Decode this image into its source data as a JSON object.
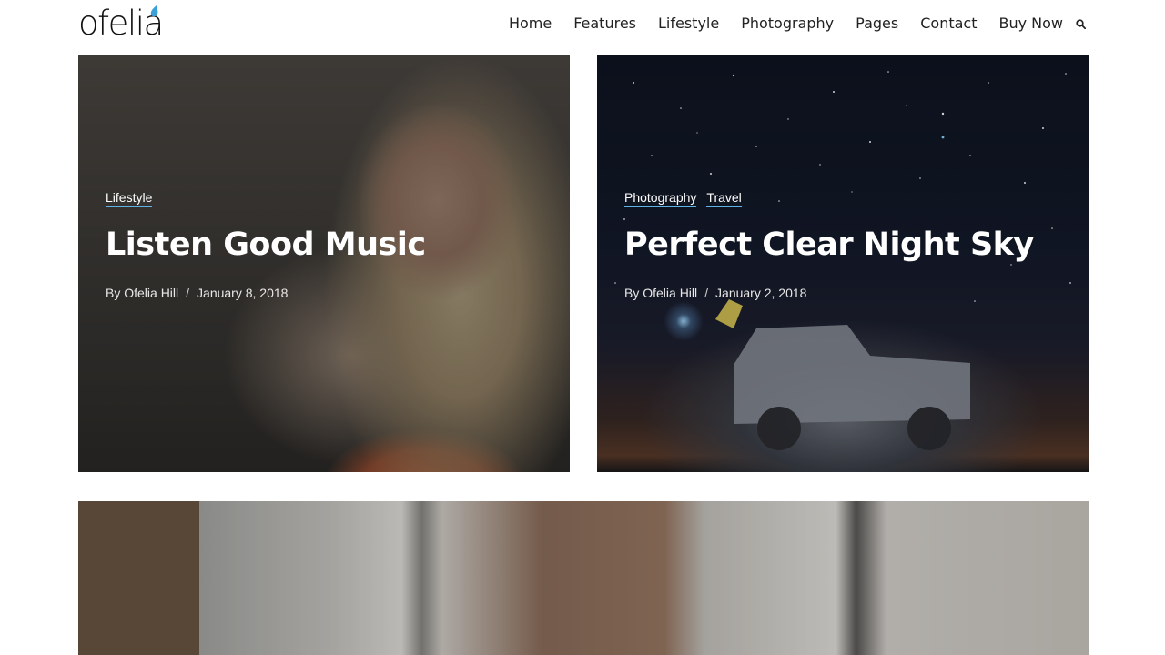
{
  "header": {
    "logo_text": "ofelia",
    "nav": [
      "Home",
      "Features",
      "Lifestyle",
      "Photography",
      "Pages",
      "Contact",
      "Buy Now"
    ],
    "search_icon": "search-icon"
  },
  "posts": [
    {
      "categories": [
        "Lifestyle"
      ],
      "title": "Listen Good Music",
      "author": "By Ofelia Hill",
      "separator": "/",
      "date": "January 8, 2018"
    },
    {
      "categories": [
        "Photography",
        "Travel"
      ],
      "title": "Perfect Clear Night Sky",
      "author": "By Ofelia Hill",
      "separator": "/",
      "date": "January 2, 2018"
    }
  ],
  "colors": {
    "accent": "#5fb2e6",
    "logo_drop": "#3aa0d8"
  }
}
